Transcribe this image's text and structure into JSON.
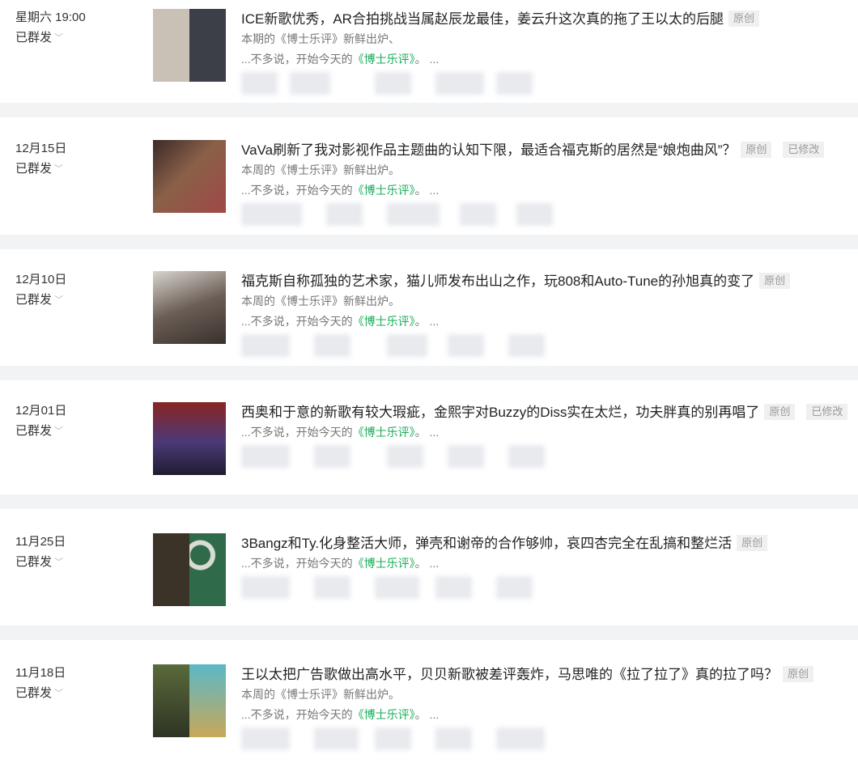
{
  "articles": [
    {
      "date": "星期六 19:00",
      "status": "已群发",
      "title": "ICE新歌优秀，AR合拍挑战当属赵辰龙最佳，姜云升这次真的拖了王以太的后腿",
      "tags": [
        "原创"
      ],
      "summary": "本期的《博士乐评》新鲜出炉、",
      "excerpt_pre": "...不多说，开始今天的",
      "excerpt_hl": "《博士乐评》",
      "excerpt_post": "。 ...",
      "thumb_colors": [
        "#c9c1b5",
        "#3c3f48"
      ]
    },
    {
      "date": "12月15日",
      "status": "已群发",
      "title": "VaVa刷新了我对影视作品主题曲的认知下限，最适合福克斯的居然是“娘炮曲风”？",
      "tags": [
        "原创",
        "已修改"
      ],
      "summary": "本周的《博士乐评》新鲜出炉。",
      "excerpt_pre": "...不多说，开始今天的",
      "excerpt_hl": "《博士乐评》",
      "excerpt_post": "。 ...",
      "thumb_colors": [
        "#3a2a28",
        "#a04848"
      ]
    },
    {
      "date": "12月10日",
      "status": "已群发",
      "title": "福克斯自称孤独的艺术家，猫儿师发布出山之作，玩808和Auto-Tune的孙旭真的变了",
      "tags": [
        "原创"
      ],
      "summary": "本周的《博士乐评》新鲜出炉。",
      "excerpt_pre": "...不多说，开始今天的",
      "excerpt_hl": "《博士乐评》",
      "excerpt_post": "。 ...",
      "thumb_colors": [
        "#d9d4ce",
        "#3a302c"
      ]
    },
    {
      "date": "12月01日",
      "status": "已群发",
      "title": "西奥和于意的新歌有较大瑕疵，金熙宇对Buzzy的Diss实在太烂，功夫胖真的别再唱了",
      "tags": [
        "原创",
        "已修改"
      ],
      "summary": "",
      "excerpt_pre": "...不多说，开始今天的",
      "excerpt_hl": "《博士乐评》",
      "excerpt_post": "。 ...",
      "thumb_colors": [
        "#4a3a78",
        "#8a2422"
      ]
    },
    {
      "date": "11月25日",
      "status": "已群发",
      "title": "3Bangz和Ty.化身整活大师，弹壳和谢帝的合作够帅，哀四杏完全在乱搞和整烂活",
      "tags": [
        "原创"
      ],
      "summary": "",
      "excerpt_pre": "...不多说，开始今天的",
      "excerpt_hl": "《博士乐评》",
      "excerpt_post": "。 ...",
      "thumb_colors": [
        "#3b3228",
        "#2f6a4a"
      ]
    },
    {
      "date": "11月18日",
      "status": "已群发",
      "title": "王以太把广告歌做出高水平，贝贝新歌被差评轰炸，马思唯的《拉了拉了》真的拉了吗？",
      "tags": [
        "原创"
      ],
      "summary": "本周的《博士乐评》新鲜出炉。",
      "excerpt_pre": "...不多说，开始今天的",
      "excerpt_hl": "《博士乐评》",
      "excerpt_post": "。 ...",
      "thumb_colors": [
        "#5a6a3a",
        "#5ab8c8"
      ]
    }
  ]
}
